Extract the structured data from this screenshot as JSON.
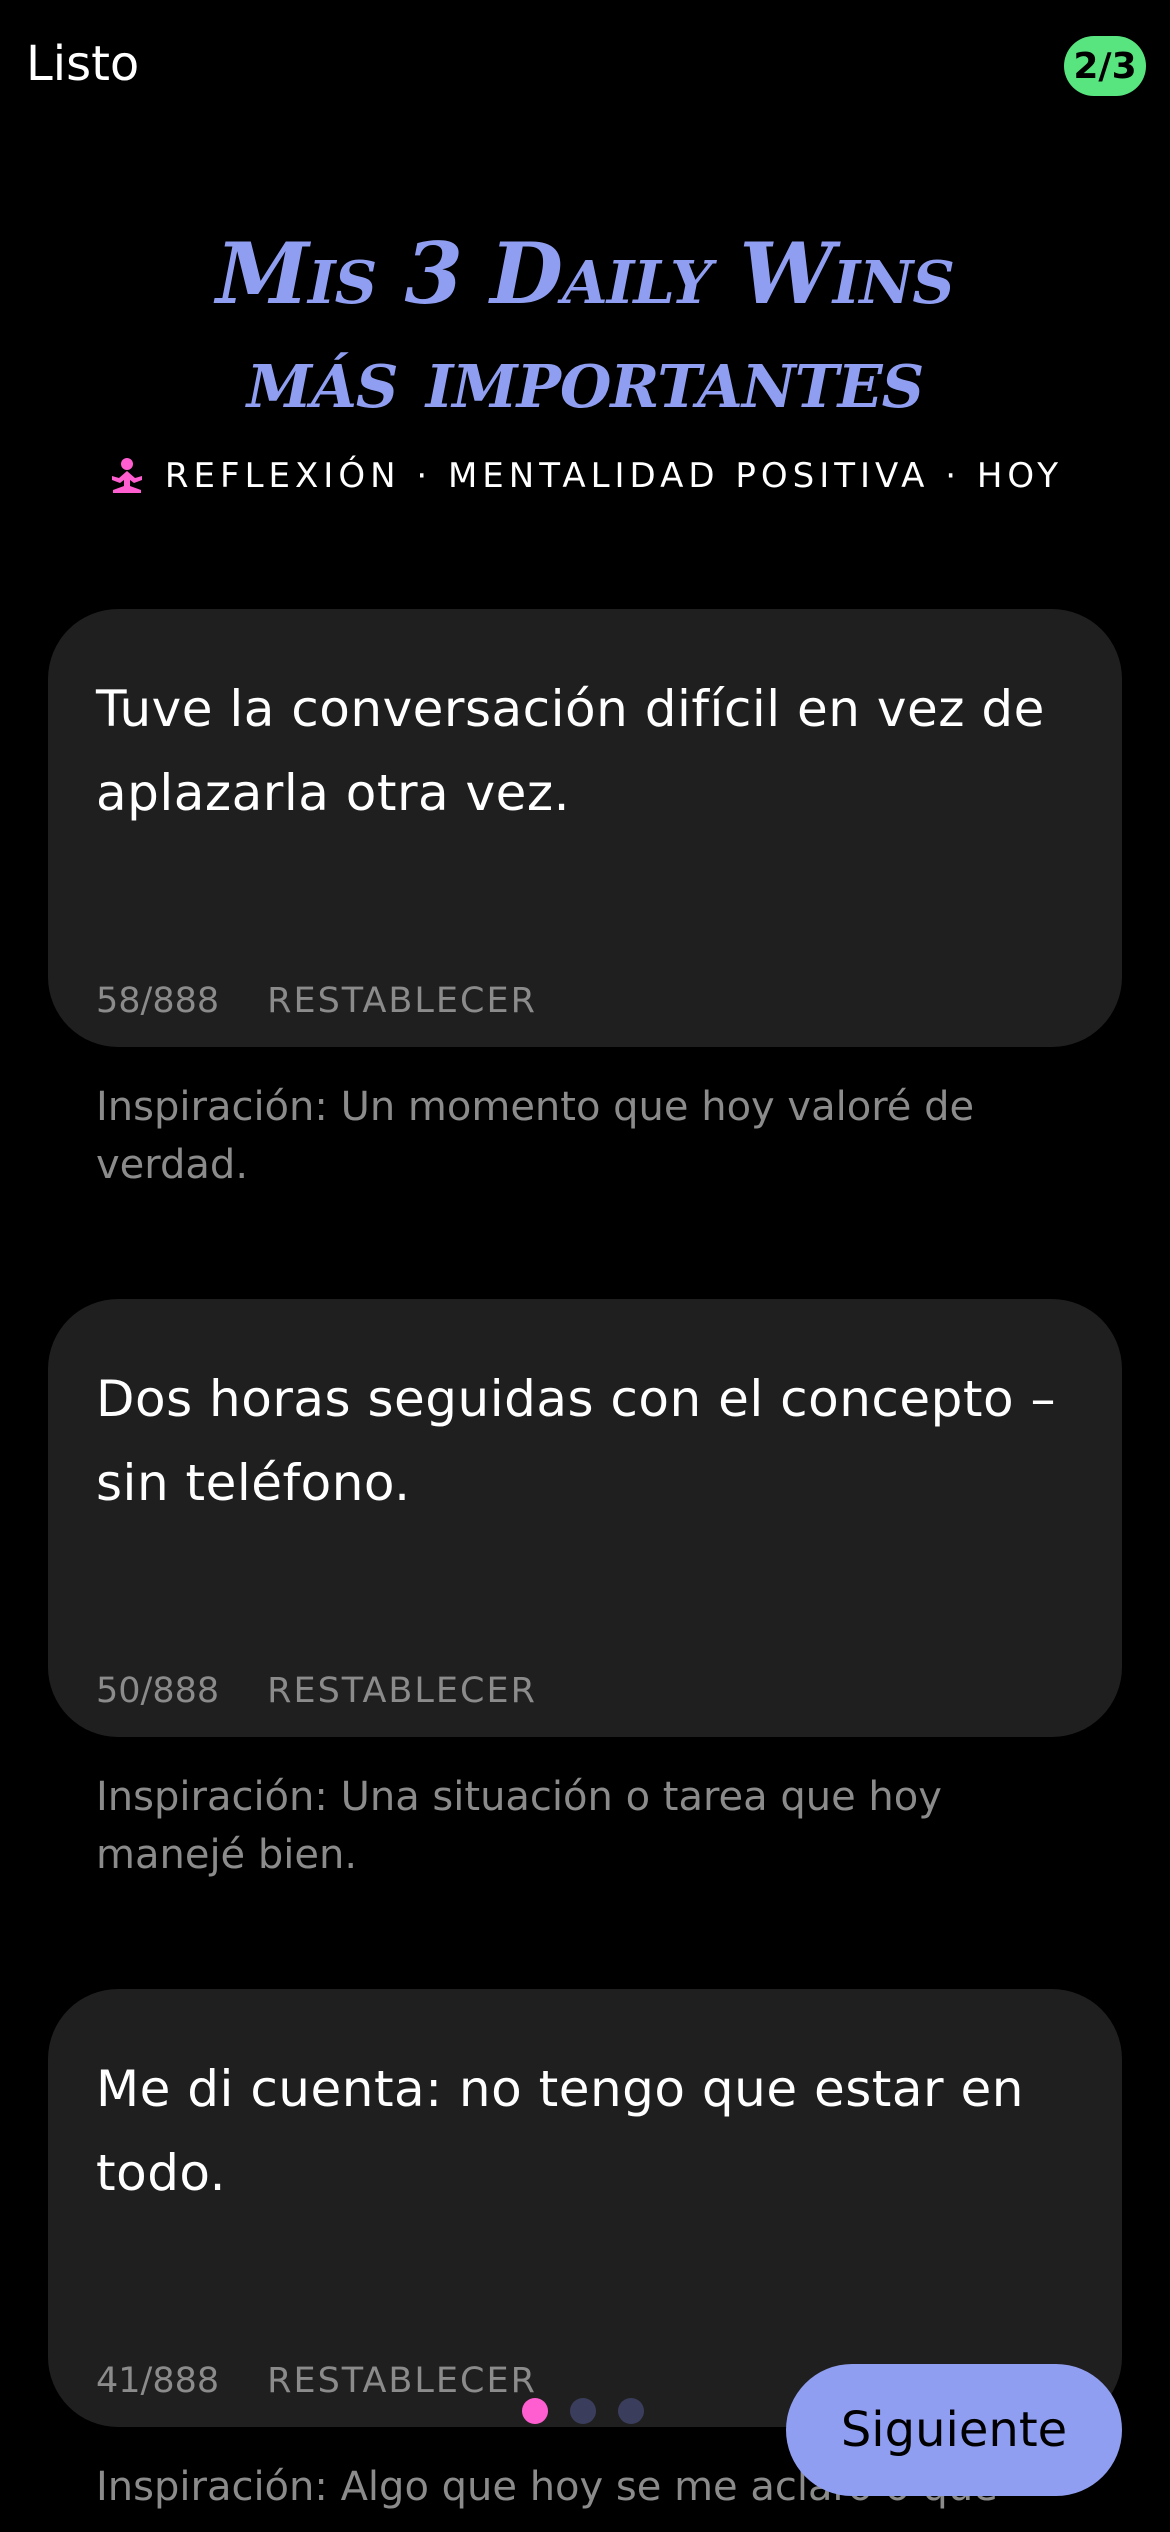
{
  "header": {
    "done_label": "Listo",
    "step": "2/3"
  },
  "title": {
    "line1": "Mis 3 Daily Wins",
    "line2": "más importantes"
  },
  "subtitle": {
    "text": "REFLEXIÓN · MENTALIDAD POSITIVA · HOY",
    "icon": "meditation-icon",
    "icon_color": "#ff5ed1"
  },
  "wins": [
    {
      "text": "Tuve la conversación difícil en vez de aplazarla otra vez.",
      "counter": "58/888",
      "reset_label": "RESTABLECER",
      "hint": "Inspiración: Un momento que hoy valoré de verdad."
    },
    {
      "text": "Dos horas seguidas con el concepto – sin teléfono.",
      "counter": "50/888",
      "reset_label": "RESTABLECER",
      "hint": "Inspiración: Una situación o tarea que hoy manejé bien."
    },
    {
      "text": "Me di cuenta: no tengo que estar en todo.",
      "counter": "41/888",
      "reset_label": "RESTABLECER",
      "hint": "Inspiración: Algo que hoy se me aclaró o que"
    }
  ],
  "pager": {
    "active_index": 0,
    "count": 3
  },
  "next_label": "Siguiente",
  "colors": {
    "accent": "#8f9ef0",
    "badge": "#58e57f",
    "dot_active": "#ff5ed1",
    "dot_inactive": "#3a3e5c",
    "card_bg": "#1f1f1f"
  }
}
